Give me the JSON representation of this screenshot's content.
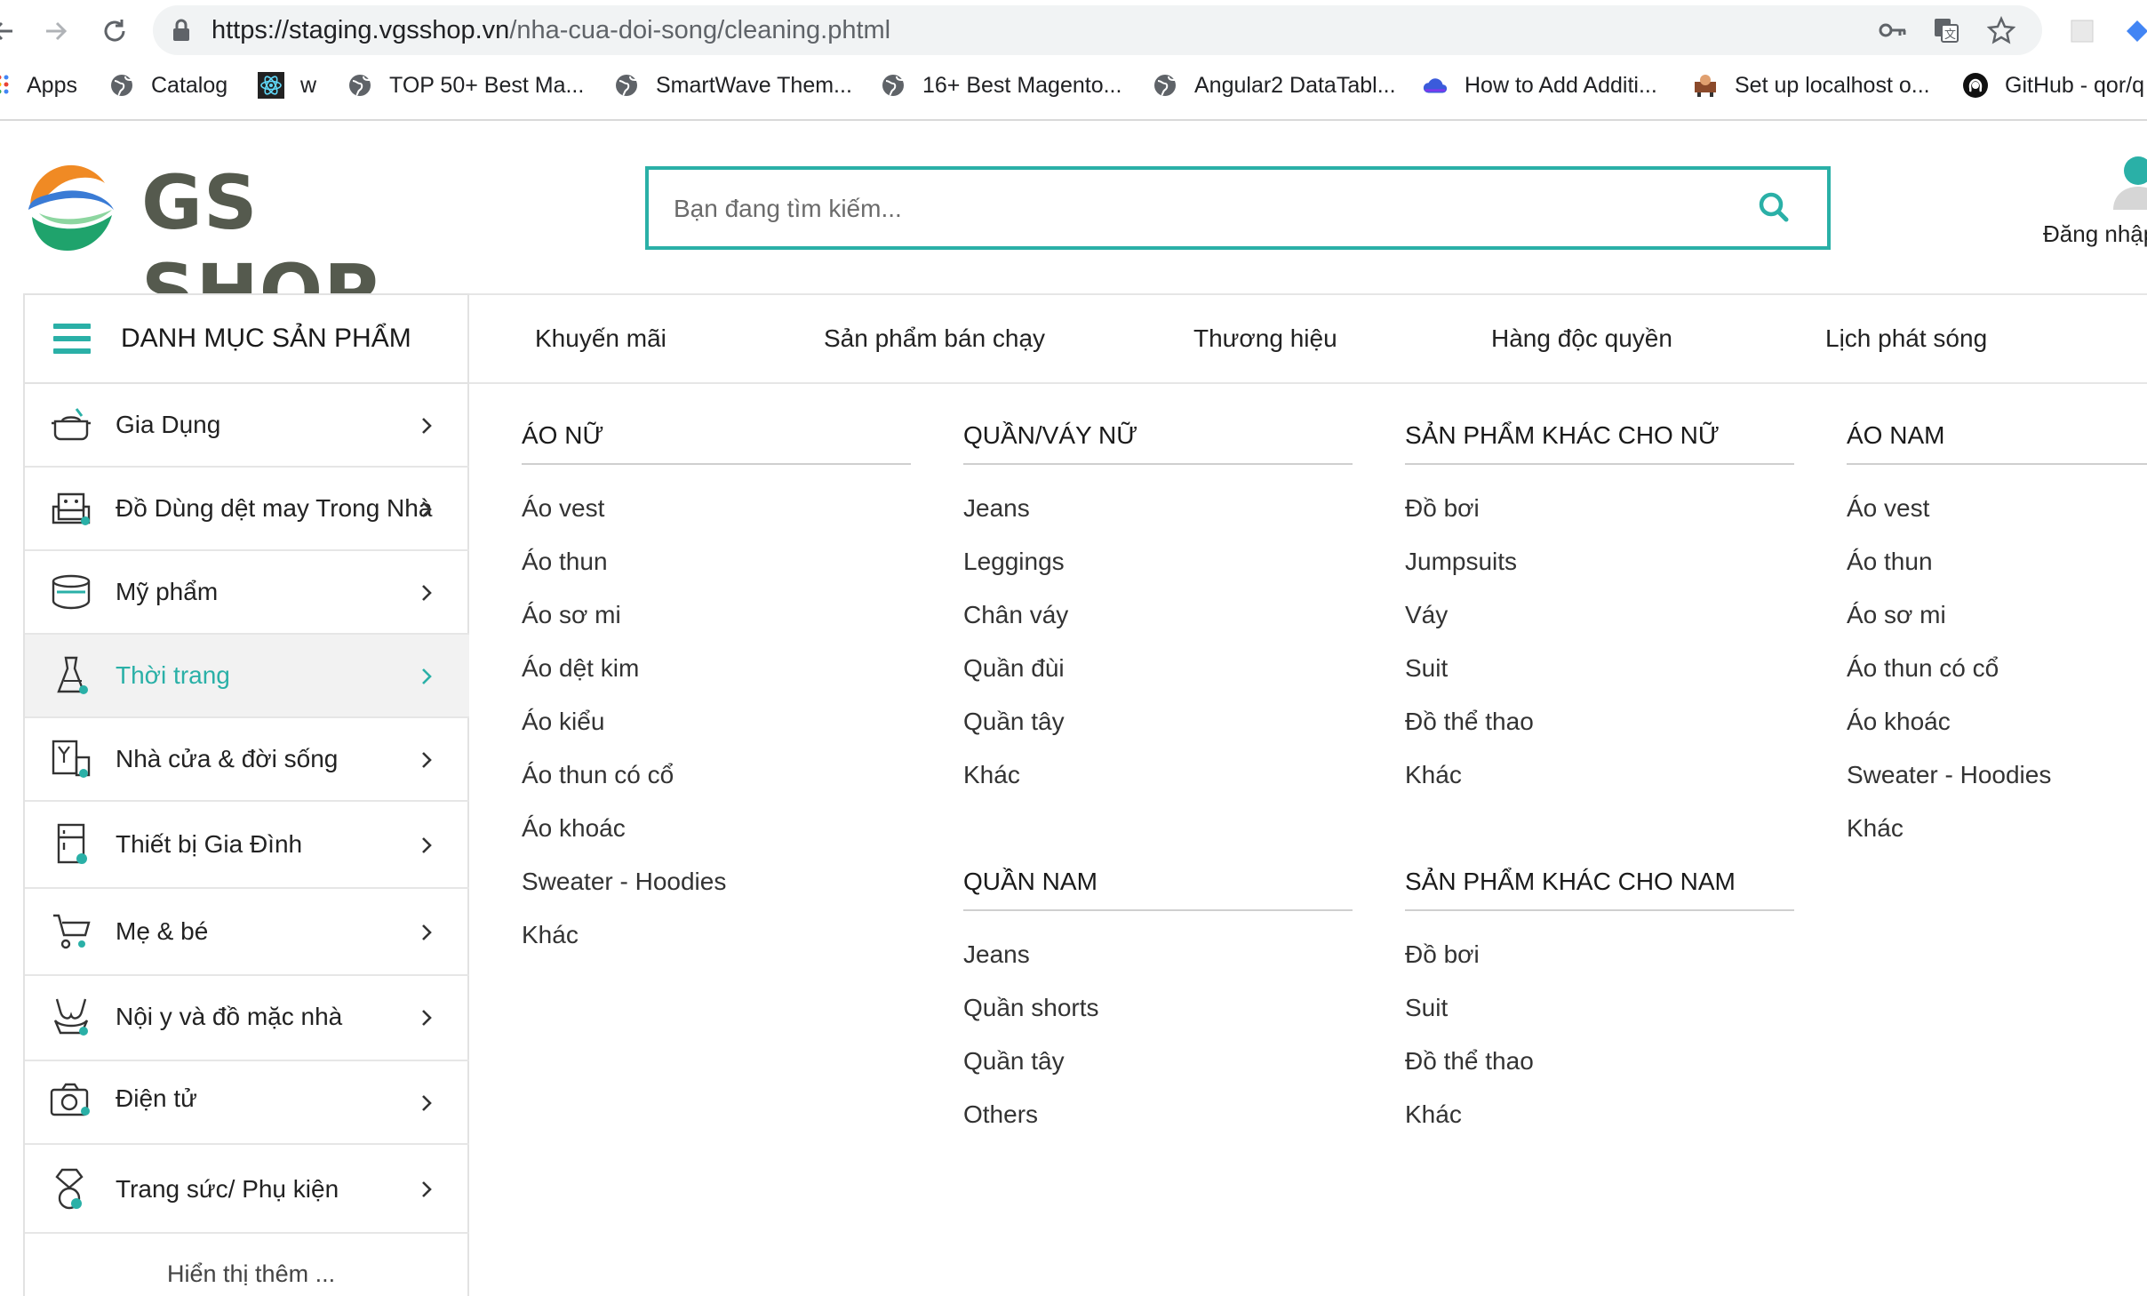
{
  "browser": {
    "url_host": "https://staging.vgsshop.vn",
    "url_path": "/nha-cua-doi-song/cleaning.phtml",
    "bookmarks": [
      {
        "label": "Apps",
        "icon": "apps-grid-icon"
      },
      {
        "label": "Catalog",
        "icon": "globe-icon"
      },
      {
        "label": "w",
        "icon": "react-icon"
      },
      {
        "label": "TOP 50+ Best Ma...",
        "icon": "globe-icon"
      },
      {
        "label": "SmartWave Them...",
        "icon": "globe-icon"
      },
      {
        "label": "16+ Best Magento...",
        "icon": "globe-icon"
      },
      {
        "label": "Angular2 DataTabl...",
        "icon": "globe-icon"
      },
      {
        "label": "How to Add Additi...",
        "icon": "cloud-icon"
      },
      {
        "label": "Set up localhost o...",
        "icon": "bookmark-image-icon"
      },
      {
        "label": "GitHub - qor/q",
        "icon": "github-icon"
      }
    ]
  },
  "header": {
    "logo_text": "GS SHOP",
    "search_placeholder": "Bạn đang tìm kiếm...",
    "login_label": "Đăng nhập"
  },
  "category_bar": {
    "title": "DANH MỤC SẢN PHẨM"
  },
  "top_nav": [
    "Khuyến mãi",
    "Sản phẩm bán chạy",
    "Thương hiệu",
    "Hàng độc quyền",
    "Lịch phát sóng"
  ],
  "sidebar": {
    "items": [
      {
        "label": "Gia Dụng",
        "icon": "kitchen-pot-icon"
      },
      {
        "label": "Đồ Dùng dệt may Trong Nhà",
        "icon": "sofa-icon"
      },
      {
        "label": "Mỹ phẩm",
        "icon": "cosmetics-jar-icon"
      },
      {
        "label": "Thời trang",
        "icon": "dress-icon",
        "active": true
      },
      {
        "label": "Nhà cửa & đời sống",
        "icon": "home-living-icon"
      },
      {
        "label": "Thiết bị Gia Đình",
        "icon": "fridge-icon"
      },
      {
        "label": "Mẹ & bé",
        "icon": "stroller-icon"
      },
      {
        "label": "Nội y và đồ mặc nhà",
        "icon": "lingerie-icon"
      },
      {
        "label": "Điện tử",
        "icon": "camera-icon"
      },
      {
        "label": "Trang sức/ Phụ kiện",
        "icon": "diamond-ring-icon"
      }
    ],
    "show_more": "Hiển thị thêm ..."
  },
  "mega_menu": {
    "columns": [
      {
        "groups": [
          {
            "title": "ÁO NỮ",
            "items": [
              "Áo vest",
              "Áo thun",
              "Áo sơ mi",
              "Áo dệt kim",
              "Áo kiểu",
              "Áo thun có cổ",
              "Áo khoác",
              "Sweater - Hoodies",
              "Khác"
            ]
          }
        ]
      },
      {
        "groups": [
          {
            "title": "QUẦN/VÁY NỮ",
            "items": [
              "Jeans",
              "Leggings",
              "Chân váy",
              "Quần đùi",
              "Quần tây",
              "Khác"
            ]
          },
          {
            "title": "QUẦN NAM",
            "items": [
              "Jeans",
              "Quần shorts",
              "Quần tây",
              "Others"
            ]
          }
        ]
      },
      {
        "groups": [
          {
            "title": "SẢN PHẨM KHÁC CHO NỮ",
            "items": [
              "Đồ bơi",
              "Jumpsuits",
              "Váy",
              "Suit",
              "Đồ thể thao",
              "Khác"
            ]
          },
          {
            "title": "SẢN PHẨM KHÁC CHO NAM",
            "items": [
              "Đồ bơi",
              "Suit",
              "Đồ thể thao",
              "Khác"
            ]
          }
        ]
      },
      {
        "groups": [
          {
            "title": "ÁO NAM",
            "items": [
              "Áo vest",
              "Áo thun",
              "Áo sơ mi",
              "Áo thun có cổ",
              "Áo khoác",
              "Sweater - Hoodies",
              "Khác"
            ]
          }
        ]
      }
    ]
  },
  "colors": {
    "accent": "#2ab0a7",
    "text": "#222222",
    "divider": "#e6e6e6"
  }
}
